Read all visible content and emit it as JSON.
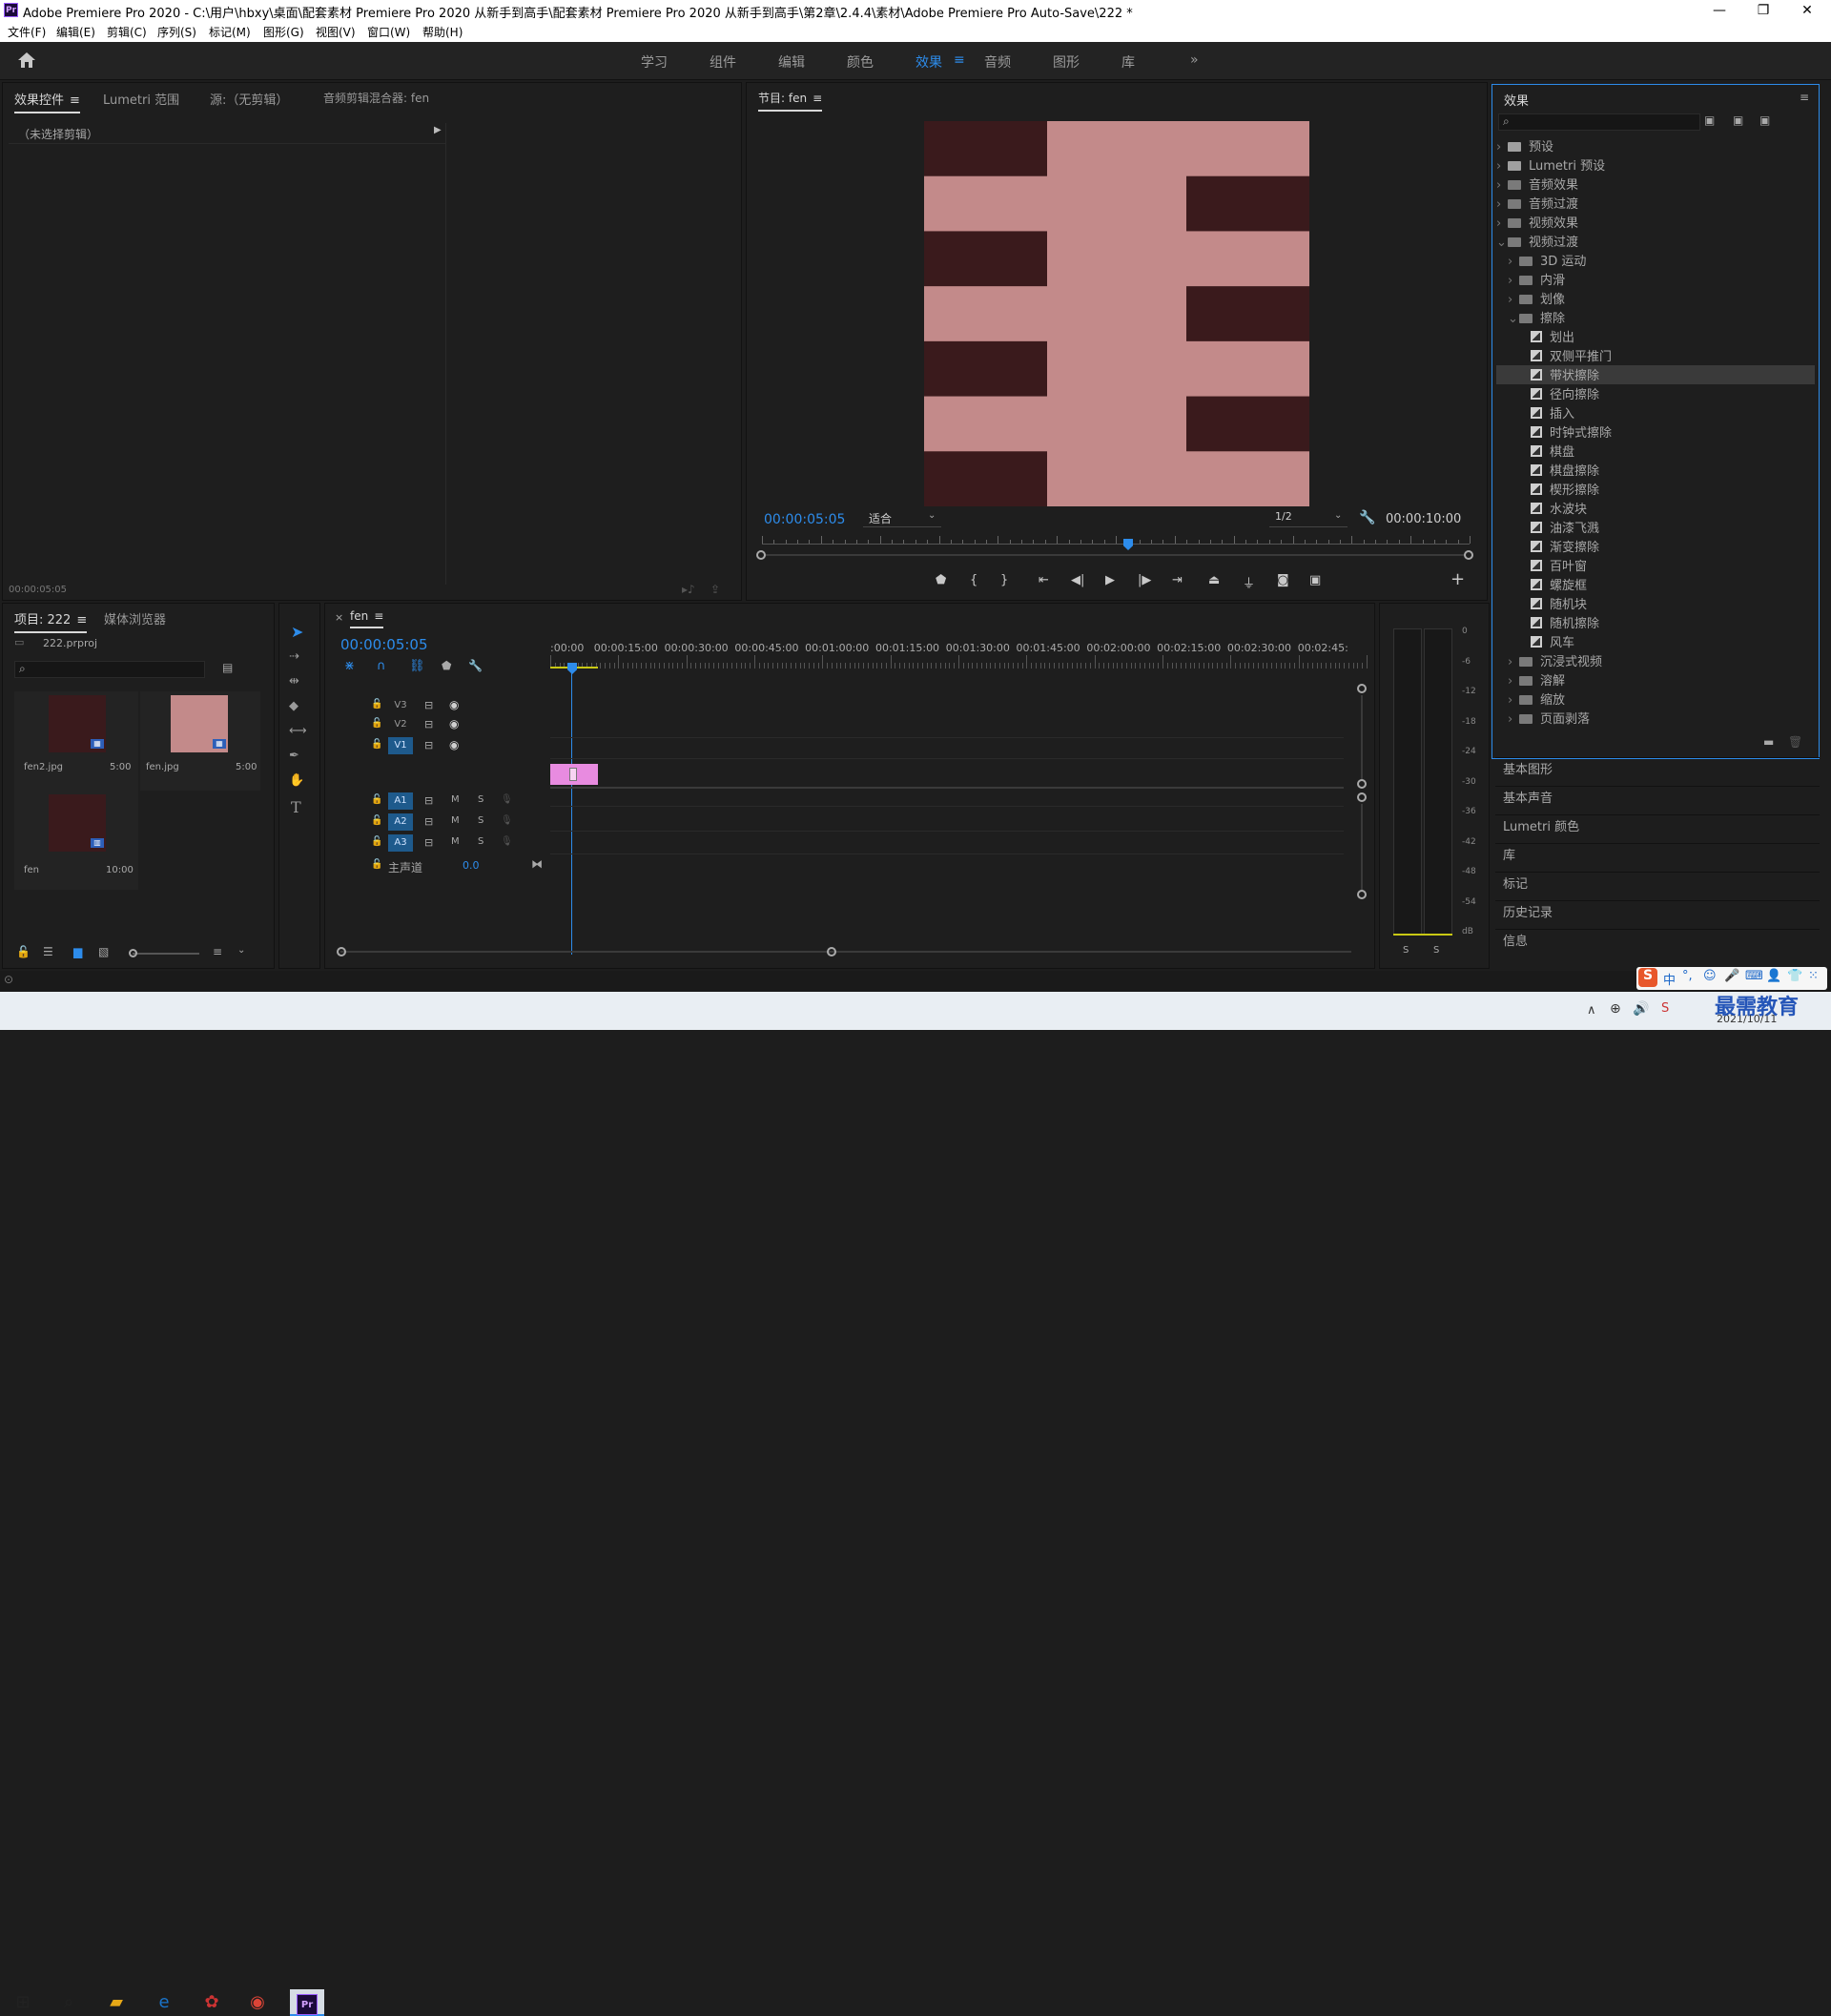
{
  "window": {
    "title": "Adobe Premiere Pro 2020 - C:\\用户\\hbxy\\桌面\\配套素材 Premiere Pro 2020 从新手到高手\\配套素材 Premiere Pro 2020 从新手到高手\\第2章\\2.4.4\\素材\\Adobe Premiere Pro Auto-Save\\222 *",
    "app_icon": "Pr",
    "minimize": "—",
    "maximize": "❐",
    "close": "✕"
  },
  "menu": [
    "文件(F)",
    "编辑(E)",
    "剪辑(C)",
    "序列(S)",
    "标记(M)",
    "图形(G)",
    "视图(V)",
    "窗口(W)",
    "帮助(H)"
  ],
  "workspaces": {
    "items": [
      "学习",
      "组件",
      "编辑",
      "颜色",
      "效果",
      "音频",
      "图形",
      "库"
    ],
    "active": "效果",
    "more": "»"
  },
  "source_panel": {
    "tabs": [
      "效果控件",
      "Lumetri 范围",
      "源:（无剪辑）",
      "音频剪辑混合器: fen"
    ],
    "no_clip": "（未选择剪辑）",
    "timecode": "00:00:05:05"
  },
  "program_monitor": {
    "tab": "节目: fen",
    "timecode": "00:00:05:05",
    "fit": "适合",
    "resolution": "1/2",
    "duration": "00:00:10:00",
    "colors": {
      "light": "#c38a8a",
      "dark": "#3a1a1c"
    }
  },
  "project_panel": {
    "tabs": [
      "项目: 222",
      "媒体浏览器"
    ],
    "file": "222.prproj",
    "items": [
      {
        "name": "fen2.jpg",
        "duration": "5:00"
      },
      {
        "name": "fen.jpg",
        "duration": "5:00"
      },
      {
        "name": "fen",
        "duration": "10:00"
      }
    ]
  },
  "timeline": {
    "tab": "fen",
    "timecode": "00:00:05:05",
    "ruler": [
      ":00:00",
      "00:00:15:00",
      "00:00:30:00",
      "00:00:45:00",
      "00:01:00:00",
      "00:01:15:00",
      "00:01:30:00",
      "00:01:45:00",
      "00:02:00:00",
      "00:02:15:00",
      "00:02:30:00",
      "00:02:45:"
    ],
    "video_tracks": [
      "V3",
      "V2",
      "V1"
    ],
    "audio_tracks": [
      "A1",
      "A2",
      "A3"
    ],
    "m": "M",
    "s": "S",
    "master": "主声道",
    "master_val": "0.0"
  },
  "meter": {
    "labels": [
      "0",
      "-6",
      "-12",
      "-18",
      "-24",
      "-30",
      "-36",
      "-42",
      "-48",
      "-54",
      "dB"
    ],
    "s": "S"
  },
  "effects_panel": {
    "title": "效果",
    "tree": [
      {
        "label": "预设",
        "level": 0,
        "kind": "folder-special",
        "open": false
      },
      {
        "label": "Lumetri 预设",
        "level": 0,
        "kind": "folder-special",
        "open": false
      },
      {
        "label": "音频效果",
        "level": 0,
        "kind": "folder",
        "open": false
      },
      {
        "label": "音频过渡",
        "level": 0,
        "kind": "folder",
        "open": false
      },
      {
        "label": "视频效果",
        "level": 0,
        "kind": "folder",
        "open": false
      },
      {
        "label": "视频过渡",
        "level": 0,
        "kind": "folder",
        "open": true
      },
      {
        "label": "3D 运动",
        "level": 1,
        "kind": "folder",
        "open": false
      },
      {
        "label": "内滑",
        "level": 1,
        "kind": "folder",
        "open": false
      },
      {
        "label": "划像",
        "level": 1,
        "kind": "folder",
        "open": false
      },
      {
        "label": "擦除",
        "level": 1,
        "kind": "folder",
        "open": true
      },
      {
        "label": "划出",
        "level": 2,
        "kind": "fx"
      },
      {
        "label": "双侧平推门",
        "level": 2,
        "kind": "fx"
      },
      {
        "label": "带状擦除",
        "level": 2,
        "kind": "fx",
        "selected": true
      },
      {
        "label": "径向擦除",
        "level": 2,
        "kind": "fx"
      },
      {
        "label": "插入",
        "level": 2,
        "kind": "fx"
      },
      {
        "label": "时钟式擦除",
        "level": 2,
        "kind": "fx"
      },
      {
        "label": "棋盘",
        "level": 2,
        "kind": "fx"
      },
      {
        "label": "棋盘擦除",
        "level": 2,
        "kind": "fx"
      },
      {
        "label": "楔形擦除",
        "level": 2,
        "kind": "fx"
      },
      {
        "label": "水波块",
        "level": 2,
        "kind": "fx"
      },
      {
        "label": "油漆飞溅",
        "level": 2,
        "kind": "fx"
      },
      {
        "label": "渐变擦除",
        "level": 2,
        "kind": "fx"
      },
      {
        "label": "百叶窗",
        "level": 2,
        "kind": "fx"
      },
      {
        "label": "螺旋框",
        "level": 2,
        "kind": "fx"
      },
      {
        "label": "随机块",
        "level": 2,
        "kind": "fx"
      },
      {
        "label": "随机擦除",
        "level": 2,
        "kind": "fx"
      },
      {
        "label": "风车",
        "level": 2,
        "kind": "fx"
      },
      {
        "label": "沉浸式视频",
        "level": 1,
        "kind": "folder",
        "open": false
      },
      {
        "label": "溶解",
        "level": 1,
        "kind": "folder",
        "open": false
      },
      {
        "label": "缩放",
        "level": 1,
        "kind": "folder",
        "open": false
      },
      {
        "label": "页面剥落",
        "level": 1,
        "kind": "folder",
        "open": false
      }
    ]
  },
  "collapsed_panels": [
    "基本图形",
    "基本声音",
    "Lumetri 颜色",
    "库",
    "标记",
    "历史记录",
    "信息"
  ],
  "taskbar": {
    "date": "2021/10/11",
    "ime": "中",
    "watermark": "最需教育"
  }
}
